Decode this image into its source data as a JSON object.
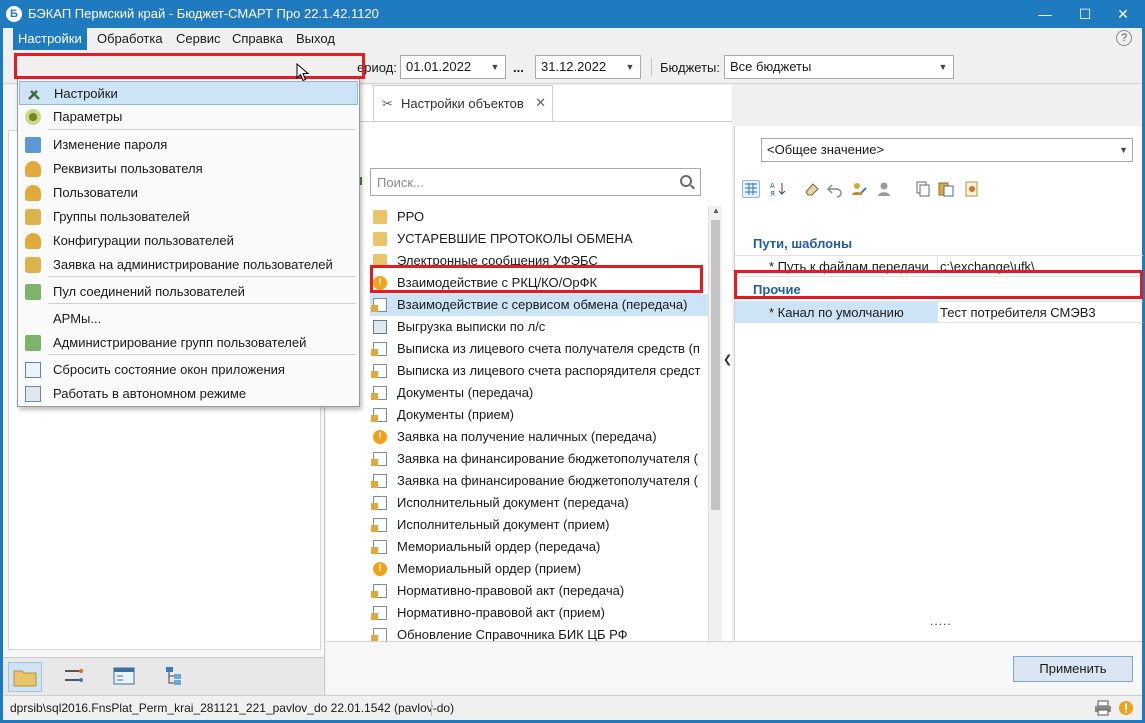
{
  "window": {
    "title": "БЭКАП Пермский край - Бюджет-СМАРТ Про 22.1.42.1120",
    "minimize": "—",
    "maximize": "☐",
    "close": "✕"
  },
  "menubar": {
    "items": [
      "Настройки",
      "Обработка",
      "Сервис",
      "Справка",
      "Выход"
    ],
    "help": "?"
  },
  "toolbar": {
    "period_label": "ериод:",
    "date_from": "01.01.2022",
    "ellipsis": "...",
    "date_to": "31.12.2022",
    "budgets_label": "Бюджеты:",
    "budgets_value": "Все бюджеты"
  },
  "dropdown": {
    "items": [
      {
        "label": "Настройки",
        "icon": "tools-icon"
      },
      {
        "label": "Параметры",
        "icon": "gear-icon"
      },
      {
        "label": "Изменение пароля",
        "icon": "key-icon"
      },
      {
        "label": "Реквизиты пользователя",
        "icon": "user-details-icon"
      },
      {
        "label": "Пользователи",
        "icon": "user-icon"
      },
      {
        "label": "Группы пользователей",
        "icon": "users-group-icon"
      },
      {
        "label": "Конфигурации пользователей",
        "icon": "user-config-icon"
      },
      {
        "label": "Заявка на администрирование пользователей",
        "icon": "user-request-icon"
      },
      {
        "label": "Пул соединений пользователей",
        "icon": "connection-pool-icon"
      },
      {
        "label": "АРМы...",
        "icon": "blank"
      },
      {
        "label": "Администрирование групп пользователей",
        "icon": "group-admin-icon"
      },
      {
        "label": "Сбросить состояние окон приложения",
        "icon": "window-reset-icon"
      },
      {
        "label": "Работать в автономном режиме",
        "icon": "offline-icon"
      }
    ]
  },
  "center": {
    "tab_label": "Настройки объектов",
    "tab_close": "✕",
    "search_placeholder": "Поиск...",
    "tree": [
      {
        "label": "РРО",
        "icon": "folder"
      },
      {
        "label": "УСТАРЕВШИЕ ПРОТОКОЛЫ ОБМЕНА",
        "icon": "folder"
      },
      {
        "label": "Электронные сообщения УФЭБС",
        "icon": "folder"
      },
      {
        "label": "Взаимодействие с РКЦ/КО/ОрФК",
        "icon": "info"
      },
      {
        "label": "Взаимодействие с сервисом обмена (передача)",
        "icon": "doc"
      },
      {
        "label": "Выгрузка выписки по л/с",
        "icon": "print"
      },
      {
        "label": "Выписка из лицевого счета получателя средств (п",
        "icon": "doc"
      },
      {
        "label": "Выписка из лицевого счета распорядителя средст",
        "icon": "doc"
      },
      {
        "label": "Документы (передача)",
        "icon": "doc"
      },
      {
        "label": "Документы (прием)",
        "icon": "doc"
      },
      {
        "label": "Заявка на получение наличных (передача)",
        "icon": "info"
      },
      {
        "label": "Заявка на финансирование бюджетополучателя (",
        "icon": "doc"
      },
      {
        "label": "Заявка на финансирование бюджетополучателя (",
        "icon": "doc"
      },
      {
        "label": "Исполнительный документ (передача)",
        "icon": "doc"
      },
      {
        "label": "Исполнительный документ (прием)",
        "icon": "doc"
      },
      {
        "label": "Мемориальный ордер (передача)",
        "icon": "doc"
      },
      {
        "label": "Мемориальный ордер (прием)",
        "icon": "info"
      },
      {
        "label": "Нормативно-правовой акт (передача)",
        "icon": "doc"
      },
      {
        "label": "Нормативно-правовой акт (прием)",
        "icon": "doc"
      },
      {
        "label": "Обновление Справочника БИК ЦБ РФ",
        "icon": "doc"
      }
    ]
  },
  "right": {
    "combo_value": "<Общее значение>",
    "groups": [
      {
        "title": "Пути, шаблоны",
        "rows": [
          {
            "name": "* Путь к файлам передачи",
            "value": "c:\\exchange\\ufk\\"
          }
        ]
      },
      {
        "title": "Прочие",
        "rows": [
          {
            "name": "* Канал по умолчанию",
            "value": "Тест потребителя СМЭВ3"
          }
        ]
      }
    ],
    "dots": "....."
  },
  "actions": {
    "apply": "Применить"
  },
  "status": {
    "text": "dprsib\\sql2016.FnsPlat_Perm_krai_281121_221_pavlov_do 22.01.1542 (pavlov-do)"
  },
  "colors": {
    "accent": "#1f7bbf",
    "selection": "#cde4f7",
    "highlight": "#e31b23"
  }
}
